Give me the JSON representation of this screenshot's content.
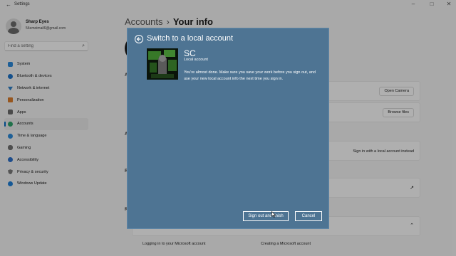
{
  "window": {
    "title": "Settings",
    "back_icon": "back-arrow-icon",
    "controls": [
      "minimize-icon",
      "maximize-icon",
      "close-icon"
    ]
  },
  "profile": {
    "name": "Sharp Eyes",
    "email": "54emoimail6@gmail.com"
  },
  "search": {
    "placeholder": "Find a setting"
  },
  "sidebar": {
    "items": [
      {
        "label": "System",
        "icon": "system-icon",
        "color": "#2b88d8"
      },
      {
        "label": "Bluetooth & devices",
        "icon": "bluetooth-icon",
        "color": "#1e73c8"
      },
      {
        "label": "Network & internet",
        "icon": "network-icon",
        "color": "#2f7fc5"
      },
      {
        "label": "Personalization",
        "icon": "personalization-icon",
        "color": "#d87b2b"
      },
      {
        "label": "Apps",
        "icon": "apps-icon",
        "color": "#6b6b6b"
      },
      {
        "label": "Accounts",
        "icon": "accounts-icon",
        "color": "#2fa36b",
        "active": true
      },
      {
        "label": "Time & language",
        "icon": "time-language-icon",
        "color": "#2c8ad8"
      },
      {
        "label": "Gaming",
        "icon": "gaming-icon",
        "color": "#707070"
      },
      {
        "label": "Accessibility",
        "icon": "accessibility-icon",
        "color": "#2b6fc8"
      },
      {
        "label": "Privacy & security",
        "icon": "shield-icon",
        "color": "#7a7a7a"
      },
      {
        "label": "Windows Update",
        "icon": "windows-update-icon",
        "color": "#1f7fd6"
      }
    ]
  },
  "main": {
    "breadcrumb_parent": "Accounts",
    "breadcrumb_current": "Your info",
    "open_camera": "Open Camera",
    "browse_files": "Browse files",
    "sign_in_local": "Sign in with a local account instead",
    "footer_links": [
      "Logging in to your Microsoft account",
      "Creating a Microsoft account"
    ]
  },
  "dialog": {
    "title": "Switch to a local account",
    "account_name": "SC",
    "account_type": "Local account",
    "message": "You're almost done. Make sure you save your work before you sign out, and use your new local account info the next time you sign in.",
    "primary_button": "Sign out and finish",
    "cancel_button": "Cancel"
  },
  "colors": {
    "dialog_bg": "#4e7493",
    "accent": "#0067c0"
  }
}
